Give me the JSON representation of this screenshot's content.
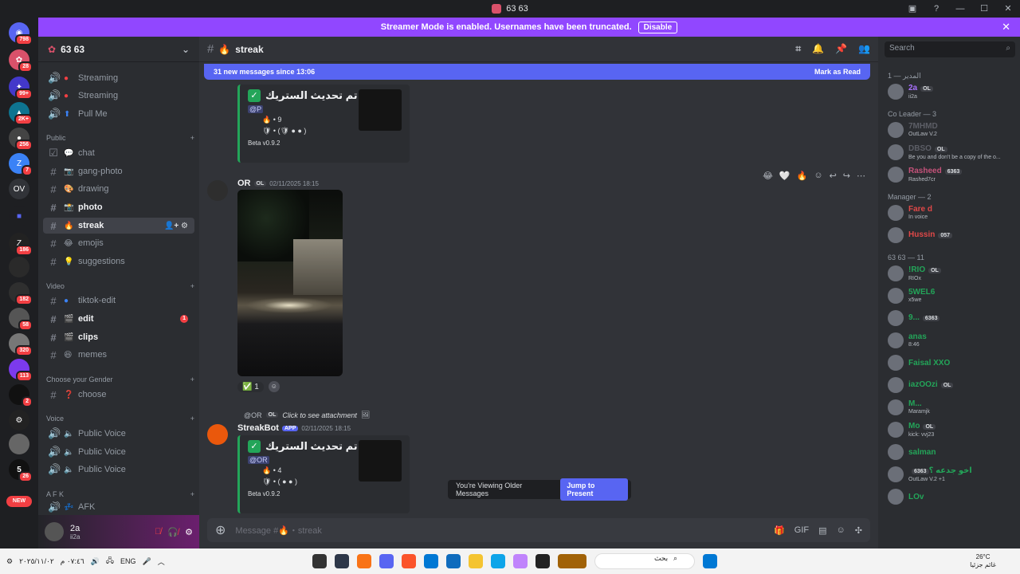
{
  "window": {
    "title": "63 63"
  },
  "banner": {
    "text": "Streamer Mode is enabled. Usernames have been truncated.",
    "button": "Disable"
  },
  "rail": {
    "badges": [
      "798",
      "28",
      "99+",
      "2K+",
      "256",
      "7",
      "186",
      "182",
      "58",
      "320",
      "113",
      "2",
      "26"
    ],
    "ov": "OV",
    "new_label": "NEW"
  },
  "server": {
    "name": "63 63"
  },
  "channels": {
    "top": [
      {
        "icon": "speaker",
        "name": "Streaming"
      },
      {
        "icon": "speaker",
        "name": "Streaming"
      },
      {
        "icon": "speaker",
        "name": "Pull Me"
      }
    ],
    "public_label": "Public",
    "public": [
      {
        "name": "chat"
      },
      {
        "name": "gang-photo"
      },
      {
        "name": "drawing"
      },
      {
        "name": "photo"
      },
      {
        "name": "streak"
      },
      {
        "name": "emojis"
      },
      {
        "name": "suggestions"
      }
    ],
    "video_label": "Video",
    "video": [
      {
        "name": "tiktok-edit"
      },
      {
        "name": "edit",
        "badge": "1"
      },
      {
        "name": "clips"
      },
      {
        "name": "memes"
      }
    ],
    "gender_label": "Choose your Gender",
    "gender": [
      {
        "name": "choose"
      }
    ],
    "voice_label": "Voice",
    "voice": [
      {
        "name": "Public Voice"
      },
      {
        "name": "Public Voice"
      },
      {
        "name": "Public Voice"
      }
    ],
    "afk_label": "A F K",
    "afk": [
      {
        "name": "AFK"
      }
    ]
  },
  "user": {
    "name": "2a",
    "status": "ii2a"
  },
  "chat": {
    "channel": "streak",
    "new_messages": "31 new messages since 13:06",
    "mark_read": "Mark as Read",
    "embed1": {
      "title": "تم تحديث الستريك",
      "mention": "@P",
      "count": "9",
      "version": "Beta v0.9.2"
    },
    "msg2": {
      "author": "OR",
      "tag": "OL",
      "time": "02/11/2025 18:15",
      "reaction": "1"
    },
    "reply": {
      "author": "@OR",
      "tag": "OL",
      "text": "Click to see attachment"
    },
    "msg3": {
      "author": "StreakBot",
      "tag": "APP",
      "time": "02/11/2025 18:15",
      "title": "تم تحديث الستريك",
      "mention": "@OR",
      "count": "4",
      "version": "Beta v0.9.2"
    },
    "older": "You're Viewing Older Messages",
    "jump": "Jump to Present",
    "composer": "Message #🔥・streak"
  },
  "members": {
    "search": "Search",
    "groups": [
      {
        "label": "المدير — 1",
        "items": [
          {
            "name": "2a",
            "tag": "OL",
            "status": "ii2a",
            "color": "#a970ff"
          }
        ]
      },
      {
        "label": "Co Leader — 3",
        "items": [
          {
            "name": "7MHMD",
            "status": "OutLaw V.2",
            "color": "#5c5e66"
          },
          {
            "name": "DBSO",
            "tag": "OL",
            "status": "Be you and don't be a copy of the o...",
            "color": "#5c5e66"
          },
          {
            "name": "Rasheed",
            "tag": "6363",
            "status": "Rashed7cr",
            "color": "#c5527a"
          }
        ]
      },
      {
        "label": "Manager — 2",
        "items": [
          {
            "name": "Fare d",
            "status": "In voice",
            "color": "#e04848"
          },
          {
            "name": "Hussin",
            "tag": "057",
            "color": "#e04848"
          }
        ]
      },
      {
        "label": "63 63 — 11",
        "items": [
          {
            "name": "!RIO",
            "tag": "OL",
            "status": "RIOx",
            "color": "#23a559"
          },
          {
            "name": "5WEL6",
            "status": "x5we",
            "color": "#23a559"
          },
          {
            "name": "9...",
            "tag": "6363",
            "color": "#23a559"
          },
          {
            "name": "anas",
            "status": "8:46",
            "color": "#23a559"
          },
          {
            "name": "Faisal XXO",
            "color": "#23a559"
          },
          {
            "name": "iazOOzi",
            "tag": "OL",
            "color": "#23a559"
          },
          {
            "name": "M...",
            "status": "Maramjk",
            "color": "#23a559"
          },
          {
            "name": "Mo",
            "tag": "OL",
            "status": "kick: vvj23",
            "color": "#23a559"
          },
          {
            "name": "salman",
            "color": "#23a559"
          },
          {
            "name": "اخو جدعه ؟",
            "tag": "6363",
            "status": "OutLaw V.2 +1",
            "color": "#23a559"
          },
          {
            "name": "LOv",
            "color": "#23a559"
          }
        ]
      }
    ]
  },
  "taskbar": {
    "lang": "ENG",
    "search": "بحث",
    "temp": "26°C",
    "weather": "غائم جزئيا",
    "time": "٠٧:٤٦ م",
    "date": "٢٠٢٥/١١/٠٢"
  }
}
